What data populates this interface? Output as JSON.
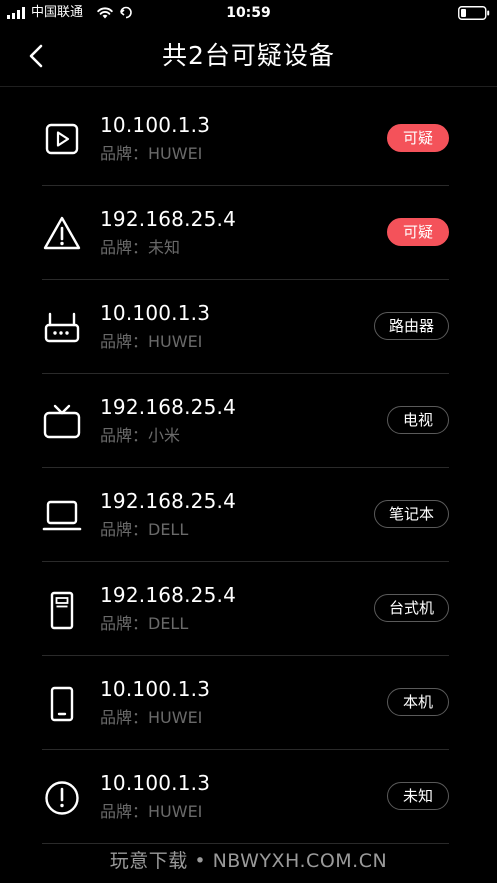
{
  "status_bar": {
    "carrier": "中国联通",
    "time": "10:59",
    "icons": [
      "signal-icon",
      "wifi-icon",
      "location-icon",
      "battery-icon"
    ]
  },
  "nav": {
    "back_icon": "chevron-left-icon",
    "title": "共2台可疑设备"
  },
  "colors": {
    "background": "#000000",
    "alert_tag": "#f4525a",
    "secondary_text": "#6a6a6a",
    "divider": "#2a2a2a"
  },
  "devices": [
    {
      "ip": "10.100.1.3",
      "brand": "品牌：HUWEI",
      "tag": "可疑",
      "tag_style": "alert",
      "icon": "media-player-icon"
    },
    {
      "ip": "192.168.25.4",
      "brand": "品牌：未知",
      "tag": "可疑",
      "tag_style": "alert",
      "icon": "warning-icon"
    },
    {
      "ip": "10.100.1.3",
      "brand": "品牌：HUWEI",
      "tag": "路由器",
      "tag_style": "normal",
      "icon": "router-icon"
    },
    {
      "ip": "192.168.25.4",
      "brand": "品牌：小米",
      "tag": "电视",
      "tag_style": "normal",
      "icon": "tv-icon"
    },
    {
      "ip": "192.168.25.4",
      "brand": "品牌：DELL",
      "tag": "笔记本",
      "tag_style": "normal",
      "icon": "laptop-icon"
    },
    {
      "ip": "192.168.25.4",
      "brand": "品牌：DELL",
      "tag": "台式机",
      "tag_style": "normal",
      "icon": "desktop-tower-icon"
    },
    {
      "ip": "10.100.1.3",
      "brand": "品牌：HUWEI",
      "tag": "本机",
      "tag_style": "normal",
      "icon": "phone-icon"
    },
    {
      "ip": "10.100.1.3",
      "brand": "品牌：HUWEI",
      "tag": "未知",
      "tag_style": "normal",
      "icon": "info-circle-icon"
    }
  ],
  "watermark": "玩意下载 • NBWYXH.COM.CN"
}
